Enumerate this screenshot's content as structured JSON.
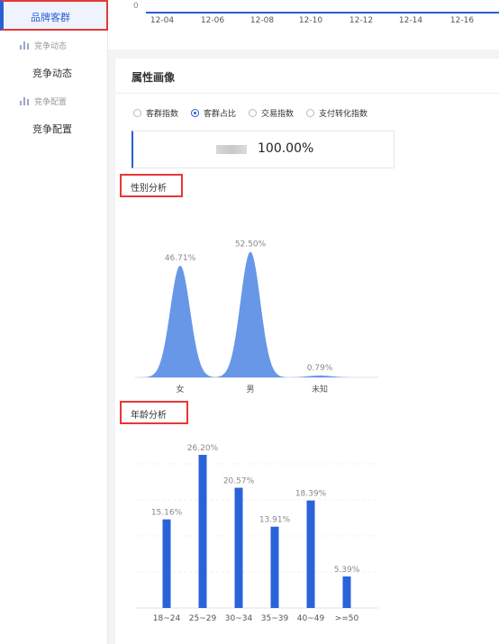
{
  "sidebar": {
    "active_item": "品牌客群",
    "groups": [
      {
        "header": "竞争动态",
        "item": "竞争动态"
      },
      {
        "header": "竞争配置",
        "item": "竞争配置"
      }
    ]
  },
  "top_chart": {
    "y_zero_label": "0",
    "x_ticks": [
      "12-04",
      "12-06",
      "12-08",
      "12-10",
      "12-12",
      "12-14",
      "12-16"
    ]
  },
  "attribute_card": {
    "title": "属性画像",
    "radios": [
      {
        "label": "客群指数",
        "selected": false
      },
      {
        "label": "客群占比",
        "selected": true
      },
      {
        "label": "交易指数",
        "selected": false
      },
      {
        "label": "支付转化指数",
        "selected": false
      }
    ],
    "summary_value": "100.00%"
  },
  "gender_section": {
    "label": "性别分析",
    "chart_data": {
      "type": "area",
      "categories": [
        "女",
        "男",
        "未知"
      ],
      "values": [
        46.71,
        52.5,
        0.79
      ],
      "value_labels": [
        "46.71%",
        "52.50%",
        "0.79%"
      ],
      "color": "#5b8ee6"
    }
  },
  "age_section": {
    "label": "年龄分析",
    "chart_data": {
      "type": "bar",
      "categories": [
        "18~24",
        "25~29",
        "30~34",
        "35~39",
        "40~49",
        ">=50"
      ],
      "values": [
        15.16,
        26.2,
        20.57,
        13.91,
        18.39,
        5.39
      ],
      "value_labels": [
        "15.16%",
        "26.20%",
        "20.57%",
        "13.91%",
        "18.39%",
        "5.39%"
      ],
      "color": "#2a62d9"
    }
  },
  "colors": {
    "accent": "#2a5fd6",
    "highlight_border": "#e53935"
  }
}
